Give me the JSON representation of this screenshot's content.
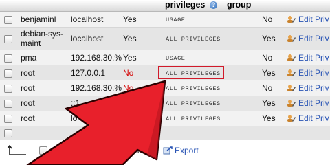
{
  "header": {
    "privileges_label": "privileges",
    "group_label": "group"
  },
  "rows": [
    {
      "user": "benjaminl",
      "host": "localhost",
      "password": "Yes",
      "privileges": "USAGE",
      "grant": "No",
      "action": "Edit Priv"
    },
    {
      "user": "debian-sys-\nmaint",
      "host": "localhost",
      "password": "Yes",
      "privileges": "ALL PRIVILEGES",
      "grant": "Yes",
      "action": "Edit Priv"
    },
    {
      "user": "pma",
      "host": "192.168.30.%",
      "password": "Yes",
      "privileges": "USAGE",
      "grant": "No",
      "action": "Edit Priv"
    },
    {
      "user": "root",
      "host": "127.0.0.1",
      "password": "No",
      "privileges": "ALL PRIVILEGES",
      "grant": "Yes",
      "action": "Edit Priv"
    },
    {
      "user": "root",
      "host": "192.168.30.%",
      "password": "No",
      "privileges": "ALL PRIVILEGES",
      "grant": "No",
      "action": "Edit Priv"
    },
    {
      "user": "root",
      "host": "::1",
      "password": "",
      "privileges": "ALL PRIVILEGES",
      "grant": "Yes",
      "action": "Edit Priv"
    },
    {
      "user": "root",
      "host": "lo",
      "password": "",
      "privileges": "ALL PRIVILEGES",
      "grant": "Yes",
      "action": "Edit Priv"
    }
  ],
  "footer": {
    "check_all_label": "Ch",
    "with_selected_label": "ected:",
    "export_label": "Export"
  },
  "colors": {
    "highlight": "#d11a2a",
    "arrow": "#e8202b",
    "link": "#2a55b5",
    "no_password": "#d40000"
  },
  "icons": [
    "help-icon",
    "edit-privileges-icon",
    "export-icon",
    "check-all-arrow-icon"
  ]
}
